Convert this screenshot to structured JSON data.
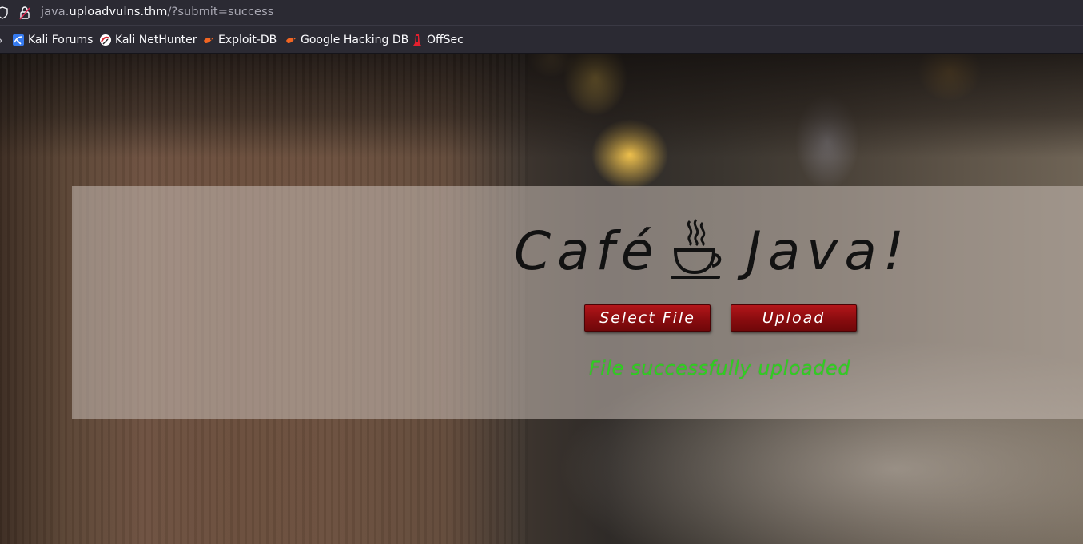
{
  "browser": {
    "url_prefix": "java.",
    "url_host": "uploadvulns.thm",
    "url_path": "/?submit=success"
  },
  "bookmarks": [
    {
      "label": "Kali Forums",
      "icon": "kali-forums-icon"
    },
    {
      "label": "Kali NetHunter",
      "icon": "kali-nethunter-icon"
    },
    {
      "label": "Exploit-DB",
      "icon": "exploit-db-icon"
    },
    {
      "label": "Google Hacking DB",
      "icon": "google-hacking-db-icon"
    },
    {
      "label": "OffSec",
      "icon": "offsec-icon"
    }
  ],
  "page": {
    "title_left": "Café",
    "title_right": "Java!",
    "title_icon": "coffee-cup-icon",
    "select_file_label": "Select File",
    "upload_label": "Upload",
    "status_message": "File successfully uploaded"
  },
  "colors": {
    "button": "#8a0c0f",
    "status": "#2fcf20",
    "panel": "#c8beb6"
  }
}
